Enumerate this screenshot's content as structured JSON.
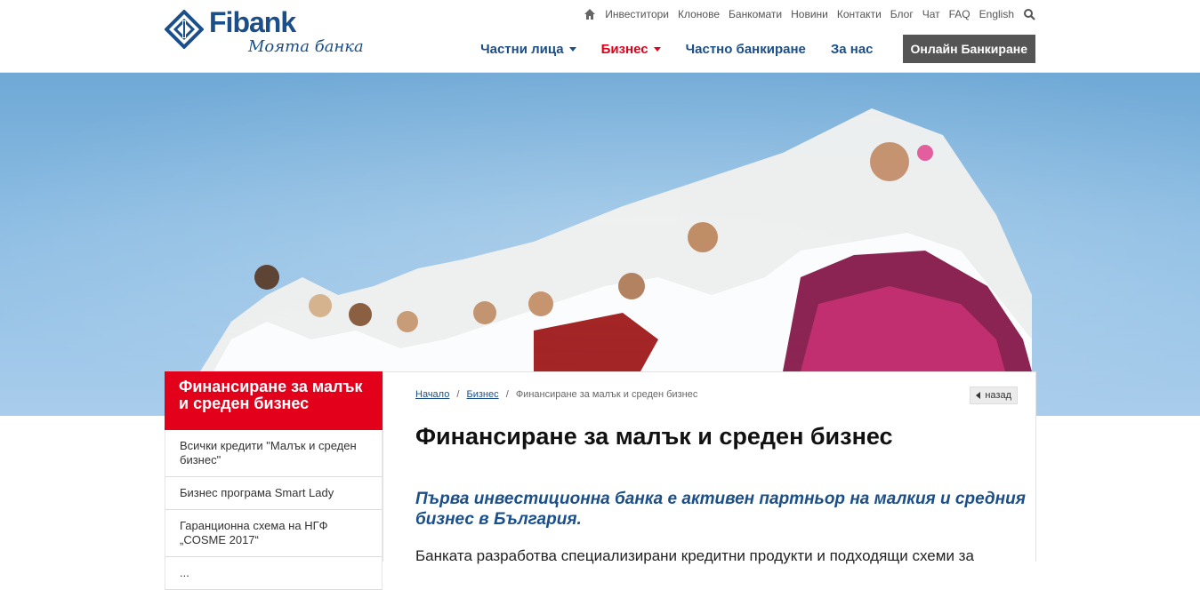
{
  "brand": {
    "name": "Fibank",
    "tagline": "Моята банка",
    "color_primary": "#1a4f8a",
    "color_accent": "#e2001a"
  },
  "topnav": {
    "home_icon": "home-icon",
    "links": [
      "Инвеститори",
      "Клонове",
      "Банкомати",
      "Новини",
      "Контакти",
      "Блог",
      "Чат",
      "FAQ",
      "English"
    ],
    "search_icon": "search-icon"
  },
  "mainnav": {
    "items": [
      {
        "label": "Частни лица",
        "dropdown": true,
        "active": false
      },
      {
        "label": "Бизнес",
        "dropdown": true,
        "active": true
      },
      {
        "label": "Частно банкиране",
        "dropdown": false,
        "active": false
      },
      {
        "label": "За нас",
        "dropdown": false,
        "active": false
      }
    ],
    "online_banking": "Онлайн Банкиране"
  },
  "sidebar": {
    "heading": "Финансиране за малък и среден бизнес",
    "links": [
      "Всички кредити \"Малък и среден бизнес\"",
      "Бизнес програма Smart Lady",
      "Гаранционна схема на НГФ „COSME 2017“",
      "..."
    ]
  },
  "content": {
    "breadcrumb": {
      "home": "Начало",
      "section": "Бизнес",
      "current": "Финансиране за малък и среден бизнес"
    },
    "back_label": "назад",
    "title": "Финансиране за малък и среден бизнес",
    "lead": "Първа инвестиционна банка е активен партньор на малкия и средния бизнес в България.",
    "body": "Банката разработва специализирани кредитни продукти и подходящи схеми за"
  }
}
